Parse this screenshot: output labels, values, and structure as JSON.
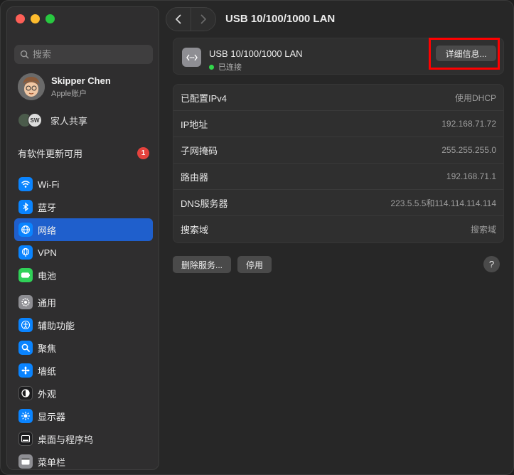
{
  "sidebar": {
    "search_placeholder": "搜索",
    "profile": {
      "name": "Skipper Chen",
      "subtitle": "Apple账户"
    },
    "family": {
      "label": "家人共享",
      "badge_initials": "SW"
    },
    "update": {
      "label": "有软件更新可用",
      "count": "1"
    },
    "group1": [
      {
        "label": "Wi-Fi",
        "icon": "wifi-icon",
        "color": "#0a84ff"
      },
      {
        "label": "蓝牙",
        "icon": "bluetooth-icon",
        "color": "#0a84ff"
      },
      {
        "label": "网络",
        "icon": "network-icon",
        "color": "#0a84ff",
        "selected": true
      },
      {
        "label": "VPN",
        "icon": "vpn-icon",
        "color": "#0a84ff"
      },
      {
        "label": "电池",
        "icon": "battery-icon",
        "color": "#30d158"
      }
    ],
    "group2": [
      {
        "label": "通用",
        "icon": "gear-icon",
        "color": "#8e8e93"
      },
      {
        "label": "辅助功能",
        "icon": "accessibility-icon",
        "color": "#0a84ff"
      },
      {
        "label": "聚焦",
        "icon": "spotlight-icon",
        "color": "#0a84ff"
      },
      {
        "label": "墙纸",
        "icon": "wallpaper-icon",
        "color": "#0a84ff"
      },
      {
        "label": "外观",
        "icon": "appearance-icon",
        "color": "#1c1c1e"
      },
      {
        "label": "显示器",
        "icon": "display-icon",
        "color": "#0a84ff"
      },
      {
        "label": "桌面与程序坞",
        "icon": "dock-icon",
        "color": "#1c1c1e"
      },
      {
        "label": "菜单栏",
        "icon": "menubar-icon",
        "color": "#8e8e93"
      }
    ]
  },
  "main": {
    "title": "USB 10/100/1000 LAN",
    "device": {
      "name": "USB 10/100/1000 LAN",
      "status": "已连接",
      "details_label": "详细信息..."
    },
    "rows": [
      {
        "label": "已配置IPv4",
        "value": "使用DHCP"
      },
      {
        "label": "IP地址",
        "value": "192.168.71.72"
      },
      {
        "label": "子网掩码",
        "value": "255.255.255.0"
      },
      {
        "label": "路由器",
        "value": "192.168.71.1"
      },
      {
        "label": "DNS服务器",
        "value": "223.5.5.5和114.114.114.114"
      },
      {
        "label": "搜索域",
        "value": "搜索域"
      }
    ],
    "buttons": {
      "remove": "删除服务...",
      "disable": "停用",
      "help": "?"
    }
  }
}
